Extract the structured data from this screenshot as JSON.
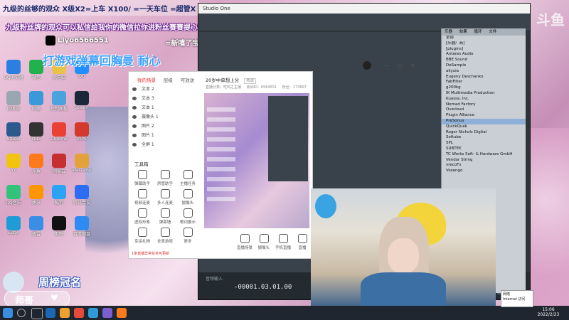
{
  "overlay": {
    "top_left_title": "九级的丝够的观众 X级X2=上车 X100/ =一天车位 =超管X",
    "banner_text": "九级粉丝牌的观众可以私信给我你的微信拉你进粉丝赛赛提心群",
    "douyin_id": "Liyo6566551",
    "new_pet_label": "=新嘻了宝贝",
    "danmu_text": "打游戏弹幕回胸曼 耐心",
    "champion_label": "周榜冠名",
    "shige_label": "师哥",
    "right_watermark": "斗鱼"
  },
  "desktop_icons": [
    {
      "label": "QQ浏览器",
      "color": "#2a7fe0"
    },
    {
      "label": "微信",
      "color": "#22b14c"
    },
    {
      "label": "此电脑",
      "color": "#e8c34a"
    },
    {
      "label": "QQ",
      "color": "#1e90ff"
    },
    {
      "label": "回收站",
      "color": "#9aa6b2"
    },
    {
      "label": "网络",
      "color": "#3a9ad9"
    },
    {
      "label": "控制面板",
      "color": "#4aa3df"
    },
    {
      "label": "Steam",
      "color": "#1b2838"
    },
    {
      "label": "Studio",
      "color": "#2c5a8c"
    },
    {
      "label": "OBS",
      "color": "#333"
    },
    {
      "label": "Chrome",
      "color": "#e94235"
    },
    {
      "label": "WPS",
      "color": "#d33a2c"
    },
    {
      "label": "YY",
      "color": "#f1c40f"
    },
    {
      "label": "斗鱼",
      "color": "#ff7a1a"
    },
    {
      "label": "网易云",
      "color": "#c62f2f"
    },
    {
      "label": "WeGame",
      "color": "#e3a33a"
    },
    {
      "label": "QQ音乐",
      "color": "#31c27c"
    },
    {
      "label": "虎牙",
      "color": "#ff9600"
    },
    {
      "label": "酷狗",
      "color": "#2ca2f9"
    },
    {
      "label": "腾讯会议",
      "color": "#2d6df6"
    },
    {
      "label": "Edge",
      "color": "#1f9cd6"
    },
    {
      "label": "迅雷",
      "color": "#3a8ee6"
    },
    {
      "label": "剪映",
      "color": "#111"
    },
    {
      "label": "百度网盘",
      "color": "#2f8af2"
    }
  ],
  "studio": {
    "title": "Studio One",
    "browser_header": [
      "乐器",
      "效果",
      "循环",
      "文件"
    ],
    "browser_items": [
      "全部",
      "[乐器厂商]",
      "[plugins]",
      "Antares Audio",
      "BBE Sound",
      "DeSample",
      "akyuia",
      "Eugeny Deschanko",
      "FabFilter",
      "g200kg",
      "IK Multimedia Production",
      "Kuassa, Inc.",
      "Nomad Factory",
      "Overloud",
      "Plugin Alliance",
      "PreSonus",
      "QuickQuak",
      "Roger Nichols Digital",
      "Softube",
      "SPL",
      "SUBTEK",
      "TC Works Soft- & Hardware GmbH",
      "Vendor String",
      "vrecoFx",
      "Voxengo"
    ],
    "timecode": "-00001.03.01.00",
    "bottom_button": "添加",
    "footer_left": "音频输入"
  },
  "obs": {
    "tabs": [
      "我的场景",
      "层级",
      "可放送"
    ],
    "layers": [
      "文本 2",
      "文本 3",
      "文本 1",
      "摄像头 1",
      "图片 2",
      "图片 1",
      "全屏 1"
    ],
    "toolbox_title": "工具箱",
    "tools": [
      "弹幕助手",
      "房管助手",
      "主播任务",
      "视频连麦",
      "多人连麦",
      "摄像头",
      "虚拟形象",
      "弹幕墙",
      "歌词展示",
      "幸运礼物",
      "全景游戏",
      "更多"
    ],
    "warning": "1条直播异常任务可更新",
    "room_title": "20岁中单想上分",
    "room_tag": "热说",
    "meta": [
      "直播分类：吃鸡之主播",
      "房间ID：6564551",
      "粉丝：173607"
    ],
    "bottom_buttons": [
      "直播场景",
      "摄像头",
      "手机直播",
      "直播"
    ]
  },
  "taskbar": {
    "time": "15:06",
    "date": "2022/2/23",
    "tooltip_line1": "网络",
    "tooltip_line2": "Internet 访问"
  }
}
